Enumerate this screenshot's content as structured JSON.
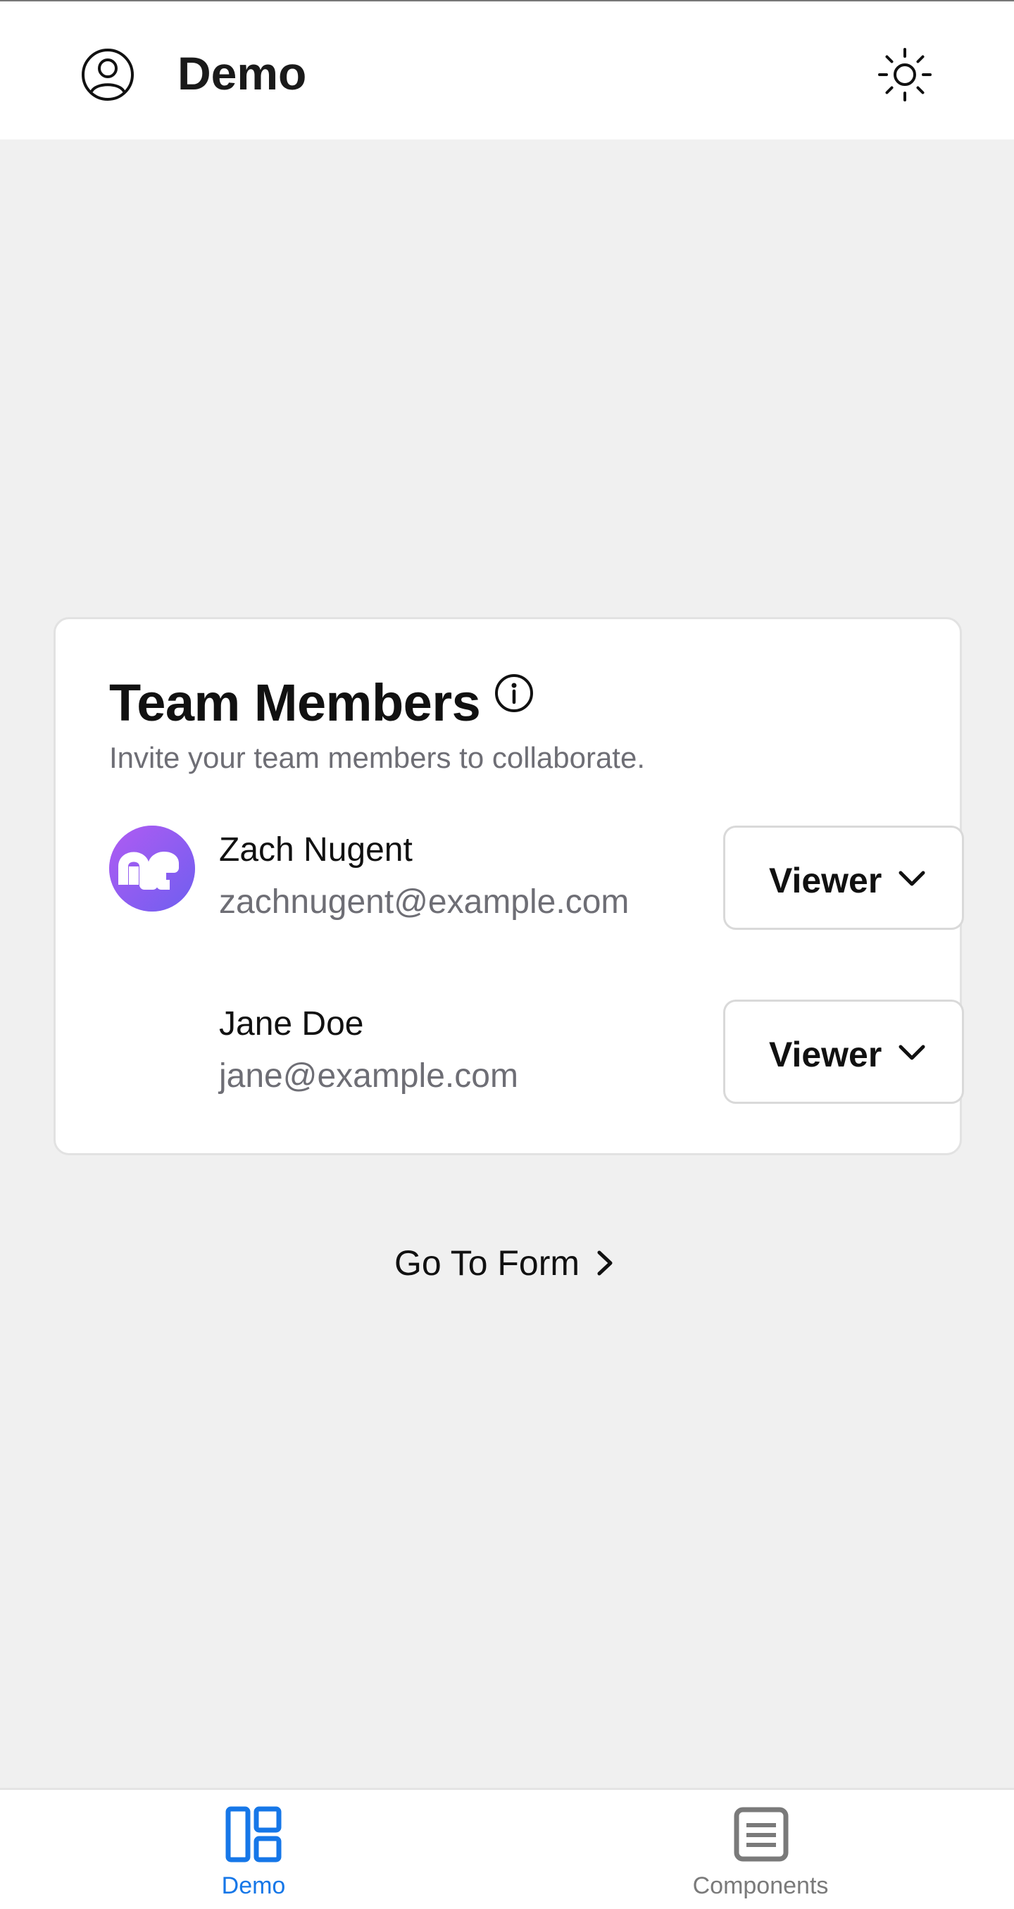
{
  "header": {
    "title": "Demo",
    "profile_icon": "user-circle-icon",
    "theme_icon": "sun-icon"
  },
  "card": {
    "title": "Team Members",
    "info_icon": "info-icon",
    "subtitle": "Invite your team members to collaborate.",
    "members": [
      {
        "name": "Zach Nugent",
        "email": "zachnugent@example.com",
        "role": "Viewer",
        "has_avatar": true
      },
      {
        "name": "Jane Doe",
        "email": "jane@example.com",
        "role": "Viewer",
        "has_avatar": false
      }
    ]
  },
  "link": {
    "label": "Go To Form"
  },
  "tabbar": {
    "tabs": [
      {
        "label": "Demo",
        "icon": "layout-grid-icon",
        "active": true
      },
      {
        "label": "Components",
        "icon": "list-box-icon",
        "active": false
      }
    ]
  },
  "colors": {
    "accent": "#1677e8",
    "avatar_gradient_start": "#a15af0",
    "avatar_gradient_end": "#7c5cf0",
    "page_background": "#f0f0f0",
    "muted_text": "#6e6e75"
  }
}
